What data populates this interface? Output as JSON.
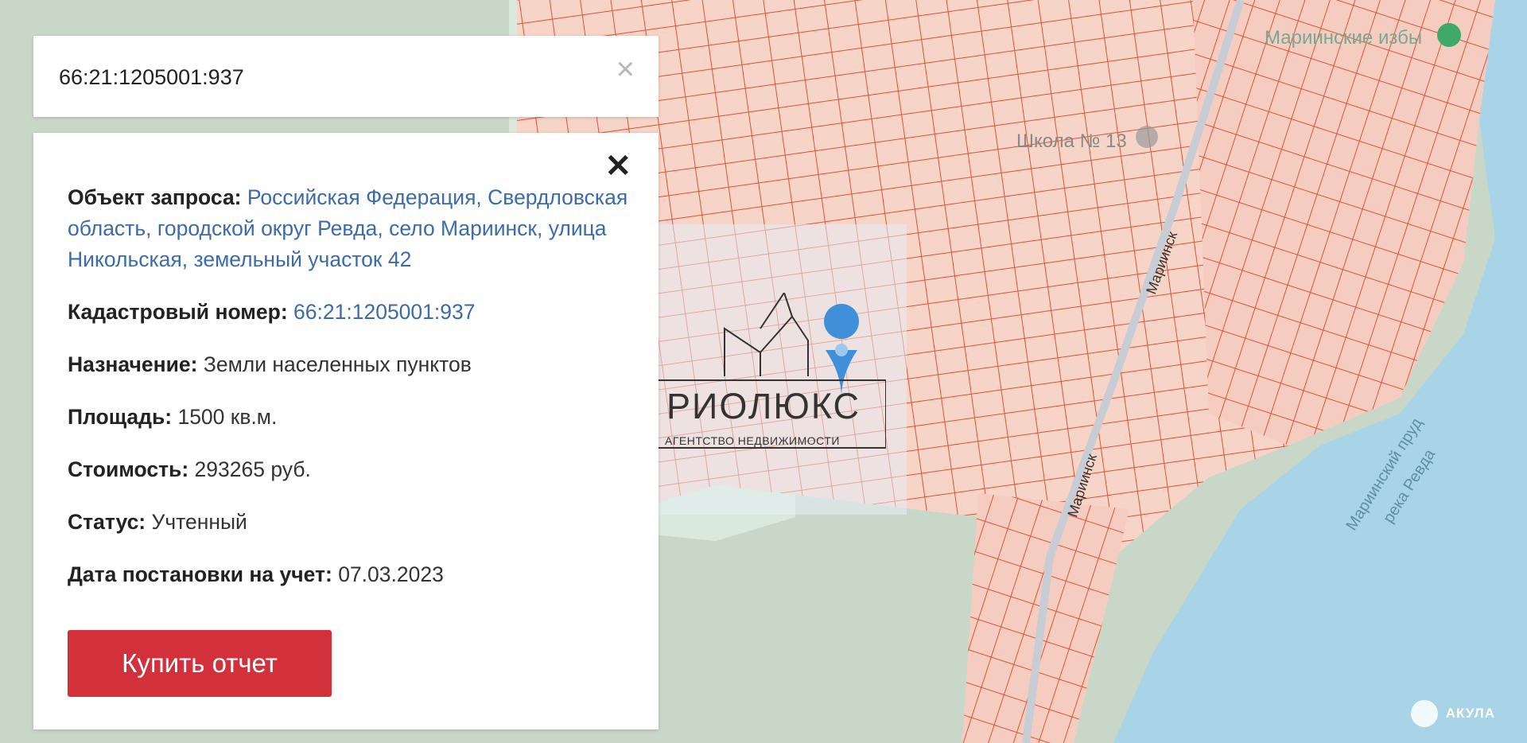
{
  "search": {
    "value": "66:21:1205001:937",
    "clear_glyph": "×"
  },
  "panel": {
    "close_glyph": "✕",
    "rows": [
      {
        "label": "Объект запроса:",
        "value": "Российская Федерация, Свердловская область, городской округ Ревда, село Мариинск, улица Никольская, земельный участок 42",
        "link": true
      },
      {
        "label": "Кадастровый номер:",
        "value": "66:21:1205001:937",
        "link": true
      },
      {
        "label": "Назначение:",
        "value": "Земли населенных пунктов",
        "link": false
      },
      {
        "label": "Площадь:",
        "value": "1500 кв.м.",
        "link": false
      },
      {
        "label": "Стоимость:",
        "value": "293265 руб.",
        "link": false
      },
      {
        "label": "Статус:",
        "value": "Учтенный",
        "link": false
      },
      {
        "label": "Дата постановки на учет:",
        "value": "07.03.2023",
        "link": false
      }
    ],
    "buy_label": "Купить отчет"
  },
  "map": {
    "labels": {
      "izby": "Мариинские избы",
      "school": "Школа № 13",
      "street1": "Мариинск",
      "street2": "Мариинск",
      "pond1": "Мариинский пруд",
      "pond2": "река Ревда"
    },
    "colors": {
      "parcel": "#e0532f",
      "parcel_fill": "#f6d4c8",
      "water": "#a9d3e6",
      "land": "#c9d7c9",
      "marker": "#3f90d8"
    }
  },
  "watermark": {
    "name": "РИОЛЮКС",
    "subtitle": "АГЕНТСТВО НЕДВИЖИМОСТИ"
  },
  "brand": {
    "akula": "АКУЛА"
  }
}
